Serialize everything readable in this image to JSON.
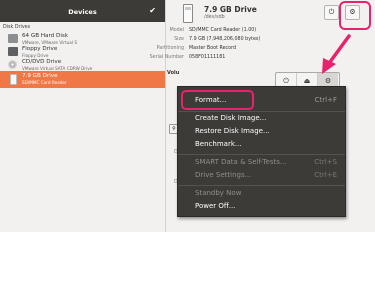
{
  "left_panel": {
    "title": "Devices",
    "check_glyph": "✔",
    "section_label": "Disk Drives",
    "drives": [
      {
        "name": "64 GB Hard Disk",
        "sub": "VMware, VMware Virtual S",
        "icon": "hard-disk-icon"
      },
      {
        "name": "Floppy Drive",
        "sub": "Floppy Drive",
        "icon": "floppy-icon"
      },
      {
        "name": "CD/DVD Drive",
        "sub": "VMware Virtual SATA CDRW Drive",
        "icon": "cd-dvd-icon"
      },
      {
        "name": "7.9 GB Drive",
        "sub": "SD/MMC Card  Reader",
        "icon": "usb-drive-icon",
        "selected": true
      }
    ]
  },
  "drive_header": {
    "title": "7.9 GB Drive",
    "device": "/dev/sdb",
    "power_glyph": "⏻",
    "gear_glyph": "⚙"
  },
  "properties": [
    {
      "label": "Model",
      "value": "SD/MMC Card  Reader (1.00)"
    },
    {
      "label": "Size",
      "value": "7.9 GB (7,948,206,080 bytes)"
    },
    {
      "label": "Partitioning",
      "value": "Master Boot Record"
    },
    {
      "label": "Serial Number",
      "value": "058F01111181"
    }
  ],
  "volumes": {
    "label": "Volu",
    "buttons": [
      {
        "name": "power-icon",
        "glyph": "⏻"
      },
      {
        "name": "eject-icon",
        "glyph": "⏏"
      },
      {
        "name": "gear-icon",
        "glyph": "⚙"
      }
    ],
    "small_button_glyph": "⚲",
    "side_letters": [
      "D",
      "D"
    ]
  },
  "menu": {
    "items": [
      {
        "label": "Format...",
        "accel": "Ctrl+F",
        "enabled": true
      },
      {
        "label": "Create Disk Image...",
        "accel": "",
        "enabled": true
      },
      {
        "label": "Restore Disk Image...",
        "accel": "",
        "enabled": true
      },
      {
        "label": "Benchmark...",
        "accel": "",
        "enabled": true
      },
      {
        "label": "SMART Data & Self-Tests...",
        "accel": "Ctrl+S",
        "enabled": false
      },
      {
        "label": "Drive Settings...",
        "accel": "Ctrl+E",
        "enabled": false
      },
      {
        "label": "Standby Now",
        "accel": "",
        "enabled": false
      },
      {
        "label": "Power Off...",
        "accel": "",
        "enabled": true
      }
    ]
  },
  "colors": {
    "selection": "#f07746",
    "menu_bg": "#3c3b37",
    "annotation": "#e8236e"
  }
}
